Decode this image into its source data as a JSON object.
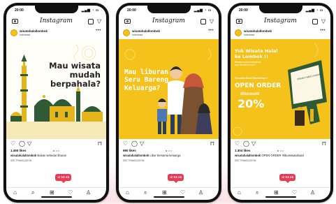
{
  "status_bar": {
    "time": "20:00",
    "signal": "▂▄▆ ◔ ▭"
  },
  "app": {
    "name": "Instagram"
  },
  "account": {
    "username": "wisatahalallombok",
    "location": "Indonesia"
  },
  "colors": {
    "brand_yellow": "#f4c21a",
    "notif_red": "#ed3954",
    "dot_active": "#3897f0"
  },
  "posts": [
    {
      "headline": [
        "Mau wisata",
        "mudah",
        "berpahala?"
      ],
      "likes": "1.450 likes",
      "caption_user": "wisatahalallombok",
      "caption_text": "Bukan sekedar liburan",
      "translation": "SEE TRANSLATION",
      "notifications": {
        "comments": "1",
        "likes": "4",
        "follows": "5"
      }
    },
    {
      "headline": [
        "Mau liburan",
        "Seru Bareng",
        "Keluarga?"
      ],
      "likes": "990 likes",
      "caption_user": "wisatahalallombok",
      "caption_text": "Libur bersama keluarga",
      "translation": "SEE TRANSLATION",
      "notifications": {
        "comments": "1",
        "likes": "4",
        "follows": "5"
      }
    },
    {
      "headline": [
        "Yuk Wisata Halal",
        "ke Lombok !!"
      ],
      "subline": [
        "Wisata mudah berpahala",
        "dan nikmati bonus !"
      ],
      "promo_caption": "Tersedia Mulai Ramadhan !!",
      "open_order": "OPEN ORDER",
      "discount_label": "discount",
      "discount_value": "20%",
      "card_text": "Wisata Halal Lombok",
      "likes": "1.304 likes",
      "caption_user": "wisatahalallombok",
      "caption_text": "OPEN ORDER #liburwisatahalal",
      "translation": "SEE TRANSLATION",
      "notifications": {
        "comments": "1",
        "likes": "4",
        "follows": "5"
      }
    }
  ]
}
